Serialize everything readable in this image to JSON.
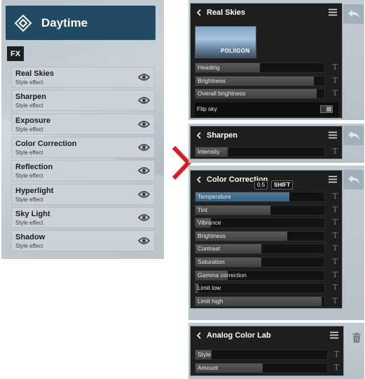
{
  "left_panel": {
    "title": "Daytime",
    "fx_badge": "FX",
    "items": [
      {
        "name": "Real Skies",
        "sub": "Style effect"
      },
      {
        "name": "Sharpen",
        "sub": "Style effect"
      },
      {
        "name": "Exposure",
        "sub": "Style effect"
      },
      {
        "name": "Color Correction",
        "sub": "Style effect"
      },
      {
        "name": "Reflection",
        "sub": "Style effect"
      },
      {
        "name": "Hyperlight",
        "sub": "Style effect"
      },
      {
        "name": "Sky Light",
        "sub": "Style effect"
      },
      {
        "name": "Shadow",
        "sub": "Style effect"
      }
    ]
  },
  "real_skies": {
    "title": "Real Skies",
    "thumbnail_logo": "POLIIGON",
    "sliders": [
      {
        "label": "Heading",
        "value": 0.5
      },
      {
        "label": "Brightness",
        "value": 0.92
      },
      {
        "label": "Overall brightness",
        "value": 0.94
      }
    ],
    "flip_sky": {
      "label": "Flip sky",
      "on": false
    }
  },
  "sharpen": {
    "title": "Sharpen",
    "sliders": [
      {
        "label": "Intensity",
        "value": 0.25
      }
    ]
  },
  "color_correction": {
    "title": "Color Correction",
    "tooltip_value": "0.5",
    "tooltip_key": "SHIFT",
    "sliders": [
      {
        "label": "Temperature",
        "value": 0.73,
        "active": true
      },
      {
        "label": "Tint",
        "value": 0.58
      },
      {
        "label": "Vibrance",
        "value": 0.12
      },
      {
        "label": "Brightness",
        "value": 0.71
      },
      {
        "label": "Contrast",
        "value": 0.51
      },
      {
        "label": "Saturation",
        "value": 0.51
      },
      {
        "label": "Gamma correction",
        "value": 0.25
      },
      {
        "label": "Limit low",
        "value": 0.02
      },
      {
        "label": "Limit high",
        "value": 0.98
      }
    ]
  },
  "analog_color_lab": {
    "title": "Analog Color Lab",
    "sliders": [
      {
        "label": "Style",
        "value": 0.12
      },
      {
        "label": "Amount",
        "value": 0.51
      }
    ]
  },
  "icons": {
    "eye": "eye-icon",
    "back": "back-arrow-icon",
    "menu": "menu-icon",
    "trash": "trash-icon",
    "chevron": "chevron-left-icon",
    "arrow": "red-arrow-icon"
  },
  "colors": {
    "header_blue": "#214a64",
    "panel_bg": "#1e1e1e",
    "accent_red": "#e0191e",
    "active_slider": "#3e6a8a"
  }
}
